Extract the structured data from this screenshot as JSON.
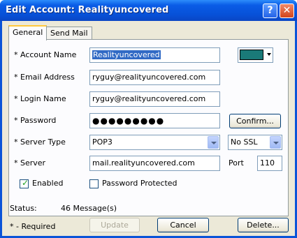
{
  "window": {
    "title": "Edit Account: Realityuncovered",
    "help_label": "?",
    "close_label": "✕"
  },
  "tabs": [
    {
      "label": "General",
      "active": true
    },
    {
      "label": "Send Mail",
      "active": false
    }
  ],
  "form": {
    "account_name": {
      "label": "* Account Name",
      "value": "Realityuncovered"
    },
    "account_color": "#1a7a78",
    "email_address": {
      "label": "* Email Address",
      "value": "ryguy@realityuncovered.com"
    },
    "login_name": {
      "label": "* Login Name",
      "value": "ryguy@realityuncovered.com"
    },
    "password": {
      "label": "* Password",
      "value": "●●●●●●●●●"
    },
    "confirm_button": "Confirm...",
    "server_type": {
      "label": "* Server Type",
      "value": "POP3"
    },
    "ssl": {
      "value": "No SSL"
    },
    "server": {
      "label": "* Server",
      "value": "mail.realityuncovered.com"
    },
    "port": {
      "label": "Port",
      "value": "110"
    },
    "enabled": {
      "label": "Enabled",
      "checked": true
    },
    "password_protected": {
      "label": "Password Protected",
      "checked": false
    }
  },
  "status": {
    "label": "Status:",
    "value": "46 Message(s)"
  },
  "footer": {
    "required_note": "* - Required",
    "update_button": "Update",
    "cancel_button": "Cancel",
    "delete_button": "Delete..."
  }
}
